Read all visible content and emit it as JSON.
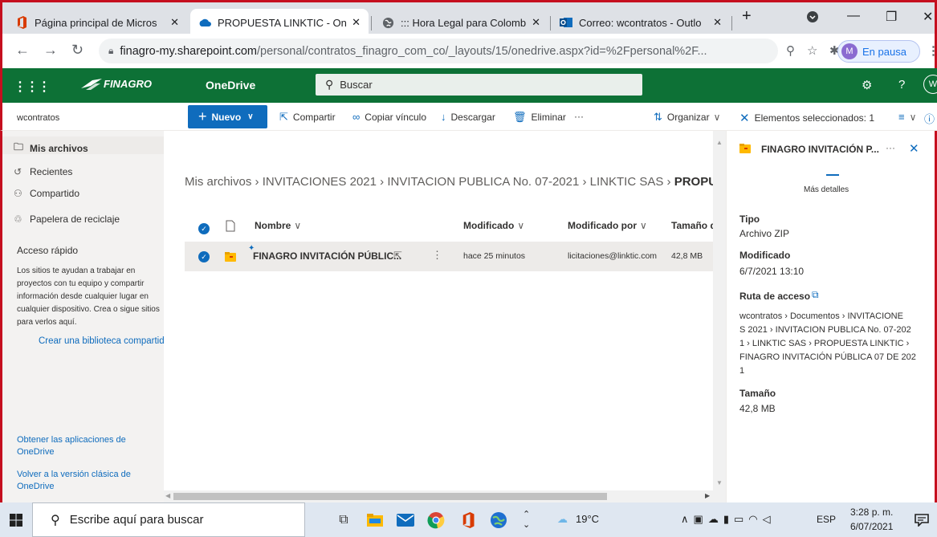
{
  "browser": {
    "tabs": [
      {
        "title": "Página principal de Micros"
      },
      {
        "title": "PROPUESTA LINKTIC - One"
      },
      {
        "title": "::: Hora Legal para Colomb"
      },
      {
        "title": "Correo: wcontratos - Outlo"
      }
    ],
    "url_host": "finagro-my.sharepoint.com",
    "url_path": "/personal/contratos_finagro_com_co/_layouts/15/onedrive.aspx?id=%2Fpersonal%2F...",
    "profile_initial": "M",
    "profile_status": "En pausa"
  },
  "appbar": {
    "brand": "FINAGRO",
    "app_name": "OneDrive",
    "search_placeholder": "Buscar"
  },
  "commandbar": {
    "site": "wcontratos",
    "new_label": "Nuevo",
    "share": "Compartir",
    "copy_link": "Copiar vínculo",
    "download": "Descargar",
    "delete": "Eliminar",
    "more": "···",
    "sort": "Organizar",
    "selected": "Elementos seleccionados: 1"
  },
  "sidebar": {
    "items": [
      {
        "label": "Mis archivos"
      },
      {
        "label": "Recientes"
      },
      {
        "label": "Compartido"
      },
      {
        "label": "Papelera de reciclaje"
      }
    ],
    "quick_access_title": "Acceso rápido",
    "quick_access_text": "Los sitios te ayudan a trabajar en proyectos con tu equipo y compartir información desde cualquier lugar en cualquier dispositivo. Crea o sigue sitios para verlos aquí.",
    "create_library": "Crear una biblioteca compartida",
    "get_apps": "Obtener las aplicaciones de OneDrive",
    "classic": "Volver a la versión clásica de OneDrive"
  },
  "main": {
    "breadcrumb": [
      "Mis archivos",
      "INVITACIONES 2021",
      "INVITACION PUBLICA No. 07-2021",
      "LINKTIC SAS",
      "PROPUESTA LINKTIC"
    ],
    "columns": {
      "name": "Nombre",
      "modified": "Modificado",
      "modified_by": "Modificado por",
      "size": "Tamaño de archivo"
    },
    "files": [
      {
        "name": "FINAGRO INVITACIÓN PÚBLIC...",
        "modified": "hace 25 minutos",
        "modified_by": "licitaciones@linktic.com",
        "size": "42,8 MB"
      }
    ]
  },
  "detail": {
    "title": "FINAGRO INVITACIÓN P...",
    "more_details": "Más detalles",
    "type_label": "Tipo",
    "type_value": "Archivo ZIP",
    "modified_label": "Modificado",
    "modified_value": "6/7/2021 13:10",
    "path_label": "Ruta de acceso",
    "path_lines": [
      "wcontratos › Documentos › INVITACIONE",
      "S 2021 › INVITACION PUBLICA No. 07-202",
      "1 › LINKTIC SAS › PROPUESTA LINKTIC ›",
      "FINAGRO INVITACIÓN PÚBLICA 07 DE 202",
      "1"
    ],
    "size_label": "Tamaño",
    "size_value": "42,8 MB"
  },
  "taskbar": {
    "search_placeholder": "Escribe aquí para buscar",
    "temperature": "19°C",
    "language": "ESP",
    "time": "3:28 p. m.",
    "date": "6/07/2021"
  },
  "colors": {
    "brand_green": "#0d7136",
    "accent_blue": "#0f6cbd",
    "frame_red": "#c50f1f"
  }
}
